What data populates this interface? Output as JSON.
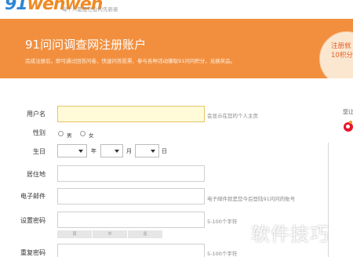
{
  "header": {
    "logo_part1": "91",
    "logo_part2": "wenwen",
    "slogan": "每个人都是社会的先驱者"
  },
  "banner": {
    "title": "91问问调查网注册账户",
    "subtitle": "完成注册后，即可通过回答问卷、快速问答投票、参与各种活动赚取91问问积分，兑换奖品。",
    "promo_line1": "注册就",
    "promo_line2": "10积分"
  },
  "form": {
    "username": {
      "label": "用户名",
      "value": "",
      "hint": "会显示在您的个人主页"
    },
    "gender": {
      "label": "性别",
      "options": [
        "男",
        "女"
      ]
    },
    "birthday": {
      "label": "生日",
      "year_unit": "年",
      "month_unit": "月",
      "day_unit": "日"
    },
    "residence": {
      "label": "居住地",
      "value": ""
    },
    "email": {
      "label": "电子邮件",
      "value": "",
      "hint": "电子邮件就是您今后登陆91问问的账号"
    },
    "password": {
      "label": "设置密码",
      "value": "",
      "hint": "5-100个字符",
      "strength_levels": [
        "弱",
        "中",
        "强"
      ]
    },
    "confirm_password": {
      "label": "重复密码",
      "value": "",
      "hint": "5-100个字符"
    }
  },
  "sidebar": {
    "login_text": "您让"
  },
  "watermark": "软件技巧",
  "colors": {
    "banner": "#f28f3e",
    "focus_field": "#fffbd9",
    "logo_blue": "#2f86d4",
    "logo_orange": "#f08a24"
  }
}
